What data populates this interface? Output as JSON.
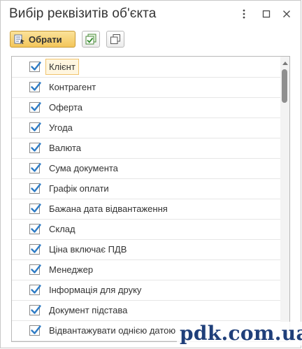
{
  "window": {
    "title": "Вибір реквізитів об'єкта"
  },
  "toolbar": {
    "choose_label": "Обрати",
    "choose_icon": "select-list-icon",
    "check_all_icon": "check-all-icon",
    "copy_icon": "copy-icon"
  },
  "list": {
    "items": [
      {
        "label": "Клієнт",
        "checked": true,
        "selected": true
      },
      {
        "label": "Контрагент",
        "checked": true
      },
      {
        "label": "Оферта",
        "checked": true
      },
      {
        "label": "Угода",
        "checked": true
      },
      {
        "label": "Валюта",
        "checked": true
      },
      {
        "label": "Сума документа",
        "checked": true
      },
      {
        "label": "Графік оплати",
        "checked": true
      },
      {
        "label": "Бажана дата відвантаження",
        "checked": true
      },
      {
        "label": "Склад",
        "checked": true
      },
      {
        "label": "Ціна включає ПДВ",
        "checked": true
      },
      {
        "label": "Менеджер",
        "checked": true
      },
      {
        "label": "Інформація для друку",
        "checked": true
      },
      {
        "label": "Документ підстава",
        "checked": true
      },
      {
        "label": "Відвантажувати однією датою",
        "checked": true
      }
    ]
  },
  "watermark": "pdk.com.ua",
  "colors": {
    "check": "#2e7bc4",
    "button_accent": "#f3c65a",
    "selected_border": "#f0c36d",
    "watermark": "#1f3f7a"
  }
}
